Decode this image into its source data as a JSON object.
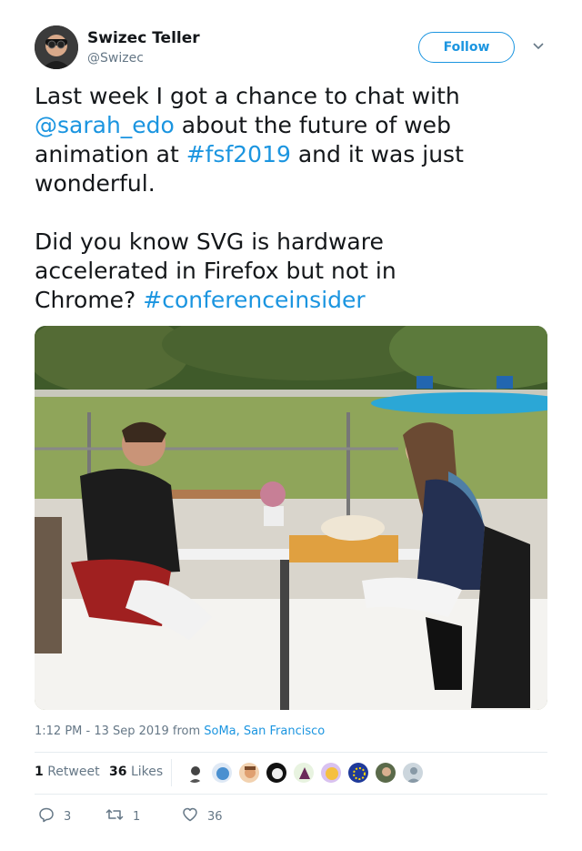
{
  "author": {
    "name": "Swizec Teller",
    "handle": "@Swizec"
  },
  "follow_label": "Follow",
  "tweet": {
    "line1a": "Last week I got a chance to chat with\n",
    "mention": "@sarah_edo",
    "line2a": " about the future of web\nanimation at ",
    "hashtag1": "#fsf2019",
    "line3a": " and it was just\nwonderful.\n\nDid you know SVG is hardware\naccelerated in Firefox but not in\nChrome? ",
    "hashtag2": "#conferenceinsider"
  },
  "meta": {
    "time": "1:12 PM - 13 Sep 2019 from ",
    "location": "SoMa, San Francisco"
  },
  "stats": {
    "retweets_count": "1",
    "retweets_label": "Retweet",
    "likes_count": "36",
    "likes_label": "Likes"
  },
  "actions": {
    "replies": "3",
    "retweets": "1",
    "likes": "36"
  },
  "colors": {
    "accent": "#1b95e0",
    "secondary_text": "#657786"
  },
  "icons": [
    "chevron-down-icon",
    "reply-icon",
    "retweet-icon",
    "heart-icon"
  ]
}
